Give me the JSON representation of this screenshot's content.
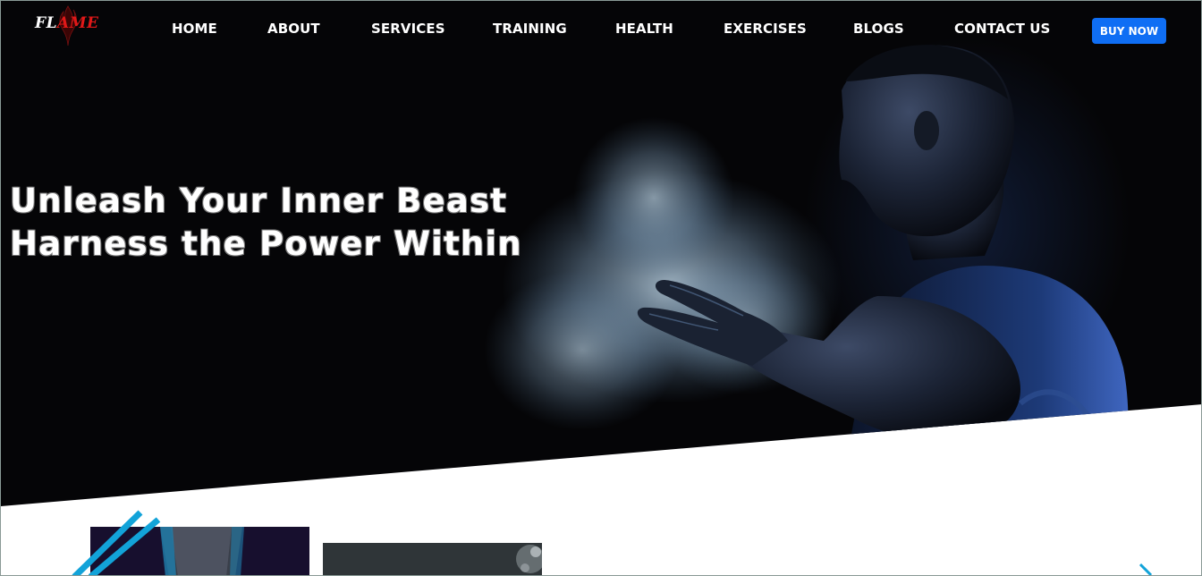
{
  "brand": {
    "logo_prefix": "FL",
    "logo_suffix": "AME"
  },
  "nav": {
    "items": [
      {
        "label": "HOME"
      },
      {
        "label": "ABOUT"
      },
      {
        "label": "SERVICES"
      },
      {
        "label": "TRAINING"
      },
      {
        "label": "HEALTH"
      },
      {
        "label": "EXERCISES"
      },
      {
        "label": "BLOGS"
      },
      {
        "label": "CONTACT US"
      }
    ],
    "cta_label": "BUY NOW"
  },
  "hero": {
    "headline_line1": "Unleash Your Inner Beast",
    "headline_line2": "Harness the Power Within"
  },
  "colors": {
    "accent": "#0f6ef4",
    "brand_red": "#e01818",
    "stripe_cyan": "#12a3d9",
    "hero_bg": "#050507"
  },
  "icons": {
    "logo_mark": "flame-icon"
  }
}
